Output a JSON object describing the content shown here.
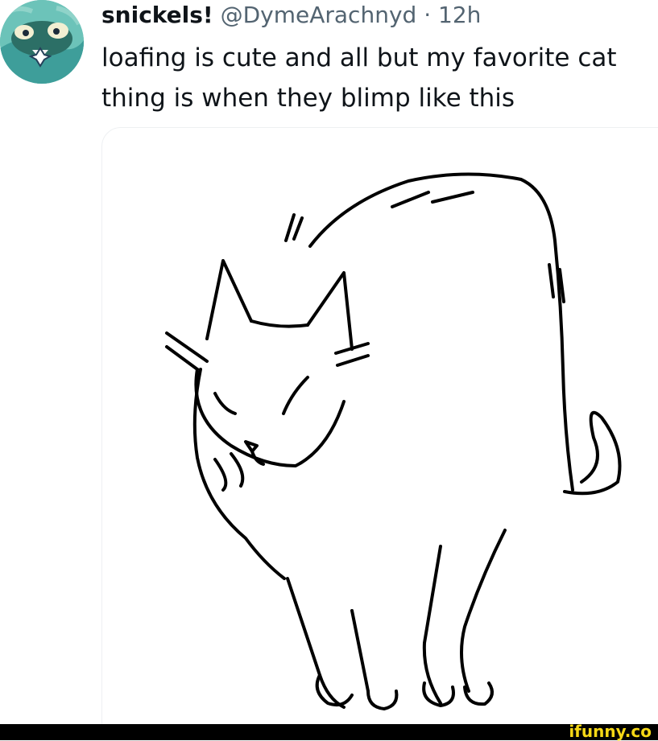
{
  "tweet": {
    "display_name": "snickels!",
    "handle": "@DymeArachnyd",
    "separator": "·",
    "time": "12h",
    "text": "loafing is cute and all but my favorite cat\nthing is when they blimp like this",
    "avatar_icon": "cartoon-character-avatar-icon",
    "media_icon": "cat-line-drawing-icon"
  },
  "watermark": {
    "text": "ifunny.co",
    "color": "#f5d716"
  },
  "colors": {
    "text_primary": "#0f1419",
    "text_secondary": "#536471",
    "card_border": "#eef0f2",
    "footer_background": "#000000"
  }
}
